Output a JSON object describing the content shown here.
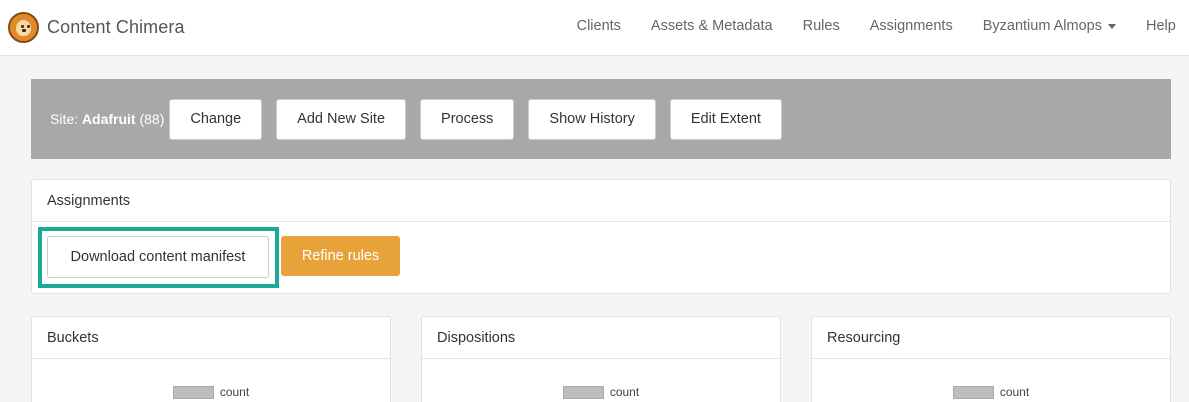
{
  "brand": {
    "name": "Content Chimera",
    "logo_icon": "lion-logo-icon"
  },
  "nav": {
    "links": [
      "Clients",
      "Assets & Metadata",
      "Rules",
      "Assignments"
    ],
    "user_menu": "Byzantium Almops",
    "help": "Help"
  },
  "site": {
    "label": "Site:",
    "name": "Adafruit",
    "count": "(88)",
    "buttons": [
      "Change",
      "Add New Site",
      "Process",
      "Show History",
      "Edit Extent"
    ]
  },
  "assignments": {
    "title": "Assignments",
    "download_label": "Download content manifest",
    "refine_label": "Refine rules",
    "highlight_color": "#1aaa95",
    "refine_color": "#e8a23a"
  },
  "panels": [
    {
      "title": "Buckets",
      "legend": "count"
    },
    {
      "title": "Dispositions",
      "legend": "count"
    },
    {
      "title": "Resourcing",
      "legend": "count"
    }
  ],
  "colors": {
    "site_bar": "#a8a8a8",
    "legend_swatch": "#bdbdbd"
  }
}
